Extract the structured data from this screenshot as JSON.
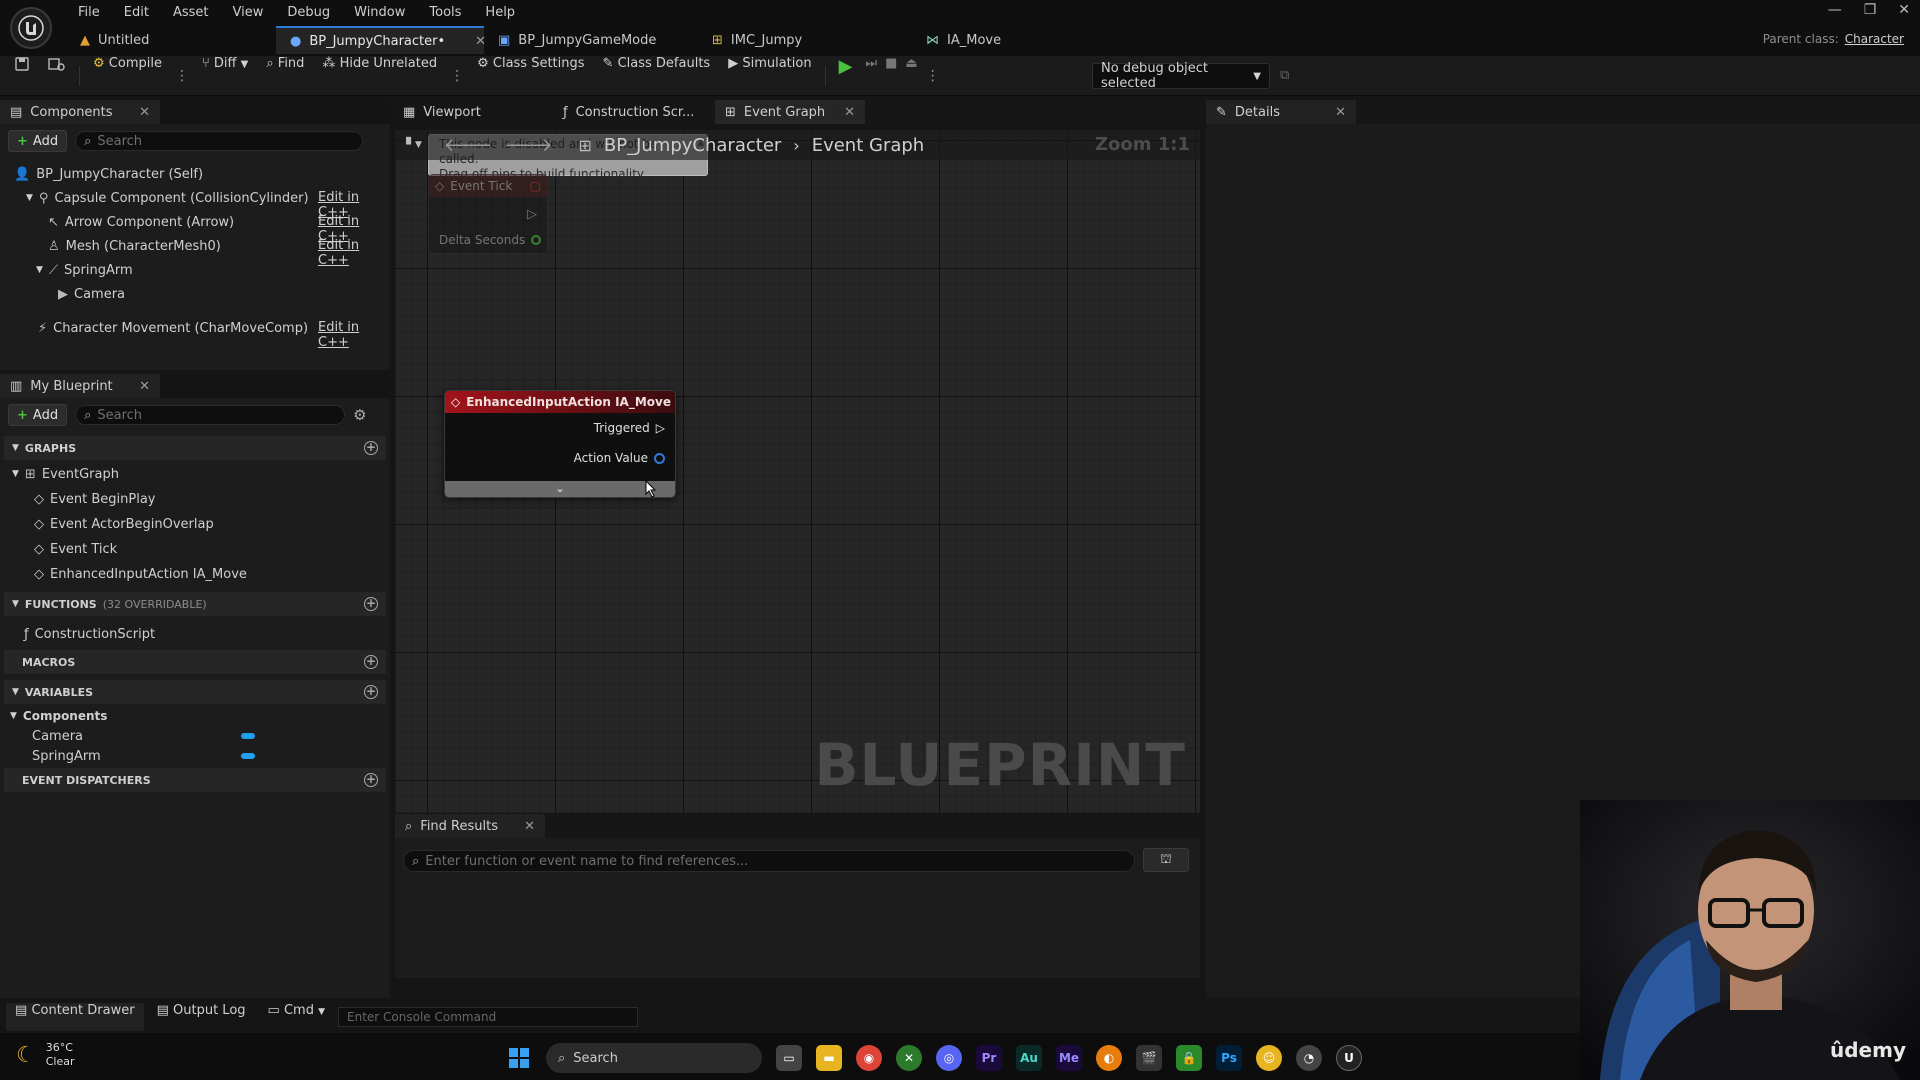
{
  "menu": [
    "File",
    "Edit",
    "Asset",
    "View",
    "Debug",
    "Window",
    "Tools",
    "Help"
  ],
  "doc_tabs": [
    {
      "label": "Untitled"
    },
    {
      "label": "BP_JumpyCharacter•"
    },
    {
      "label": "BP_JumpyGameMode"
    },
    {
      "label": "IMC_Jumpy"
    },
    {
      "label": "IA_Move"
    }
  ],
  "parent_class": {
    "label": "Parent class:",
    "value": "Character"
  },
  "toolbar": {
    "compile": "Compile",
    "diff": "Diff",
    "find": "Find",
    "hide_unrelated": "Hide Unrelated",
    "class_settings": "Class Settings",
    "class_defaults": "Class Defaults",
    "simulation": "Simulation",
    "debug_object": "No debug object selected"
  },
  "components": {
    "tab": "Components",
    "add": "Add",
    "search_placeholder": "Search",
    "self": "BP_JumpyCharacter (Self)",
    "items": [
      {
        "label": "Capsule Component (CollisionCylinder)",
        "edit": "Edit in C++"
      },
      {
        "label": "Arrow Component (Arrow)",
        "edit": "Edit in C++"
      },
      {
        "label": "Mesh (CharacterMesh0)",
        "edit": "Edit in C++"
      },
      {
        "label": "SpringArm"
      },
      {
        "label": "Camera"
      },
      {
        "label": "Character Movement (CharMoveComp)",
        "edit": "Edit in C++"
      }
    ]
  },
  "my_blueprint": {
    "tab": "My Blueprint",
    "add": "Add",
    "search_placeholder": "Search",
    "graphs_header": "GRAPHS",
    "event_graph": "EventGraph",
    "events": [
      "Event BeginPlay",
      "Event ActorBeginOverlap",
      "Event Tick",
      "EnhancedInputAction IA_Move"
    ],
    "functions_header": "FUNCTIONS",
    "functions_note": "(32 OVERRIDABLE)",
    "construction_script": "ConstructionScript",
    "macros_header": "MACROS",
    "variables_header": "VARIABLES",
    "components_group": "Components",
    "variables": [
      "Camera",
      "SpringArm"
    ],
    "dispatchers_header": "EVENT DISPATCHERS"
  },
  "graph_tabs": [
    {
      "label": "Viewport"
    },
    {
      "label": "Construction Scr..."
    },
    {
      "label": "Event Graph"
    }
  ],
  "breadcrumb": {
    "root": "BP_JumpyCharacter",
    "leaf": "Event Graph"
  },
  "zoom": "Zoom 1:1",
  "watermark": "BLUEPRINT",
  "disabled_note": {
    "line1": "This node is disabled and will not be called.",
    "line2": "Drag off pins to build functionality."
  },
  "event_tick_node": {
    "title": "Event Tick",
    "pin": "Delta Seconds"
  },
  "input_node": {
    "title": "EnhancedInputAction IA_Move",
    "pins": [
      "Triggered",
      "Action Value"
    ]
  },
  "details": {
    "tab": "Details"
  },
  "find_results": {
    "tab": "Find Results",
    "placeholder": "Enter function or event name to find references..."
  },
  "status": {
    "content_drawer": "Content Drawer",
    "output_log": "Output Log",
    "cmd": "Cmd",
    "console_placeholder": "Enter Console Command"
  },
  "taskbar": {
    "weather_temp": "36°C",
    "weather_desc": "Clear",
    "search": "Search",
    "apps": [
      "Pr",
      "Au",
      "Me",
      "Ps"
    ]
  },
  "udemy": "ûdemy",
  "colors": {
    "accent": "#2d7bd8",
    "event_red": "#a3141b",
    "var_blue": "#1fa0f0",
    "exec_green": "#2faa3c"
  }
}
